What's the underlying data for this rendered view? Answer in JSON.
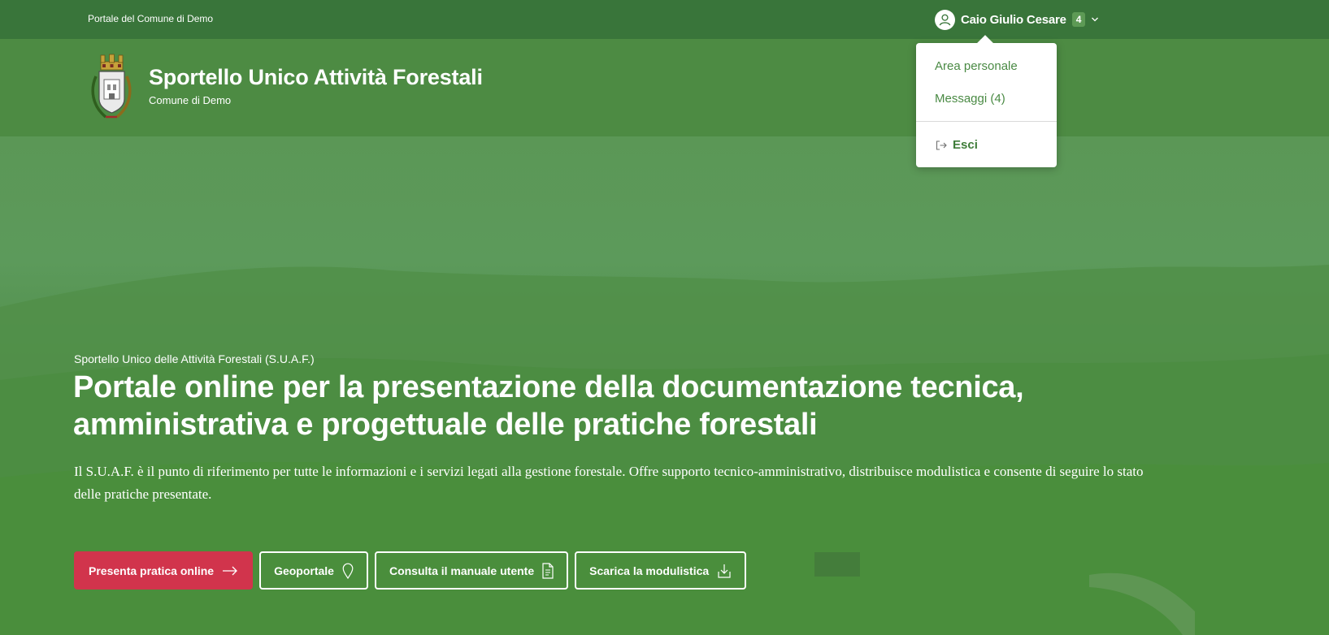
{
  "topbar": {
    "org_link": "Portale del Comune di Demo",
    "user": {
      "name": "Caio Giulio Cesare",
      "badge": "4",
      "avatar_icon": "user-icon",
      "chevron_icon": "chevron-down-icon"
    }
  },
  "header": {
    "title": "Sportello Unico Attività Forestali",
    "subtitle": "Comune di Demo",
    "logo_icon": "municipal-crest-icon"
  },
  "user_menu": {
    "items": [
      {
        "label": "Area personale"
      },
      {
        "label": "Messaggi (4)"
      }
    ],
    "logout": {
      "label": "Esci",
      "icon": "logout-icon"
    }
  },
  "hero": {
    "eyebrow": "Sportello Unico delle Attività Forestali (S.U.A.F.)",
    "title": "Portale online per la presentazione della documentazione tecnica, amministrativa e progettuale delle pratiche forestali",
    "description": "Il S.U.A.F. è il punto di riferimento per tutte le informazioni e i servizi legati alla gestione forestale. Offre supporto tecnico-amministrativo, distribuisce modulistica e consente di seguire lo stato delle pratiche presentate.",
    "actions": [
      {
        "label": "Presenta pratica online",
        "icon": "arrow-right-icon",
        "style": "primary"
      },
      {
        "label": "Geoportale",
        "icon": "map-pin-icon",
        "style": "outline"
      },
      {
        "label": "Consulta il manuale utente",
        "icon": "document-icon",
        "style": "outline"
      },
      {
        "label": "Scarica la modulistica",
        "icon": "download-icon",
        "style": "outline"
      }
    ]
  },
  "colors": {
    "topbar": "#39753a",
    "header": "#4d8b43",
    "primary_button": "#d1344c",
    "menu_text": "#4a8a44"
  }
}
